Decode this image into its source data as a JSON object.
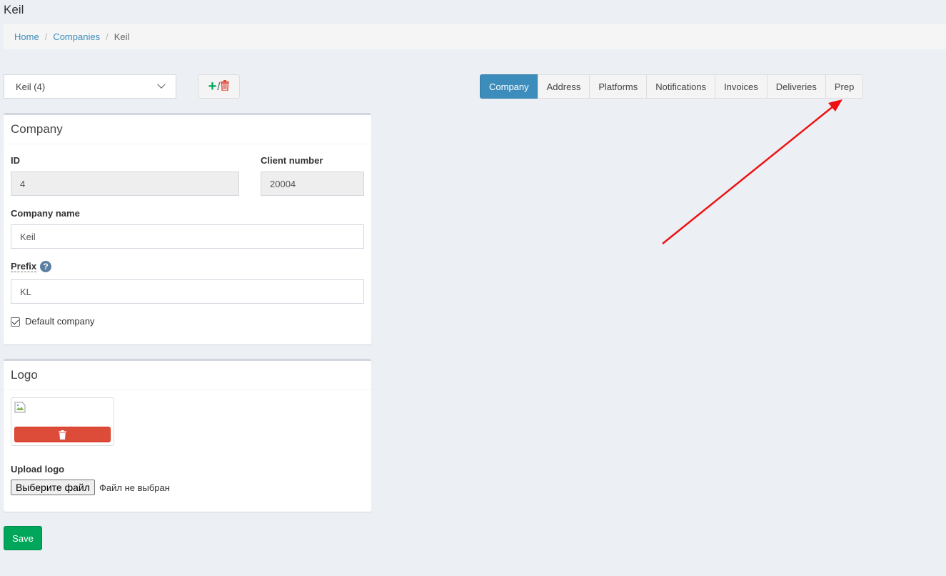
{
  "page": {
    "title": "Keil"
  },
  "breadcrumb": {
    "items": [
      "Home",
      "Companies"
    ],
    "current": "Keil"
  },
  "company_selector": {
    "selected": "Keil (4)"
  },
  "add_remove": {
    "slash": "/"
  },
  "tabs": [
    "Company",
    "Address",
    "Platforms",
    "Notifications",
    "Invoices",
    "Deliveries",
    "Prep"
  ],
  "active_tab": "Company",
  "company_box": {
    "title": "Company",
    "id_label": "ID",
    "id_value": "4",
    "client_number_label": "Client number",
    "client_number_value": "20004",
    "company_name_label": "Company name",
    "company_name_value": "Keil",
    "prefix_label": "Prefix",
    "prefix_help": "?",
    "prefix_value": "KL",
    "default_company_label": "Default company",
    "default_company_checked": true
  },
  "logo_box": {
    "title": "Logo",
    "upload_label": "Upload logo",
    "file_button": "Выберите файл",
    "file_status": "Файл не выбран"
  },
  "save_button": "Save",
  "colors": {
    "primary": "#3c8dbc",
    "success": "#00a65a",
    "danger": "#dd4b39",
    "annotation_arrow": "#ee1111"
  },
  "icons": [
    "chevron-down-icon",
    "plus-icon",
    "trash-icon",
    "help-icon",
    "check-icon",
    "broken-image-icon"
  ]
}
